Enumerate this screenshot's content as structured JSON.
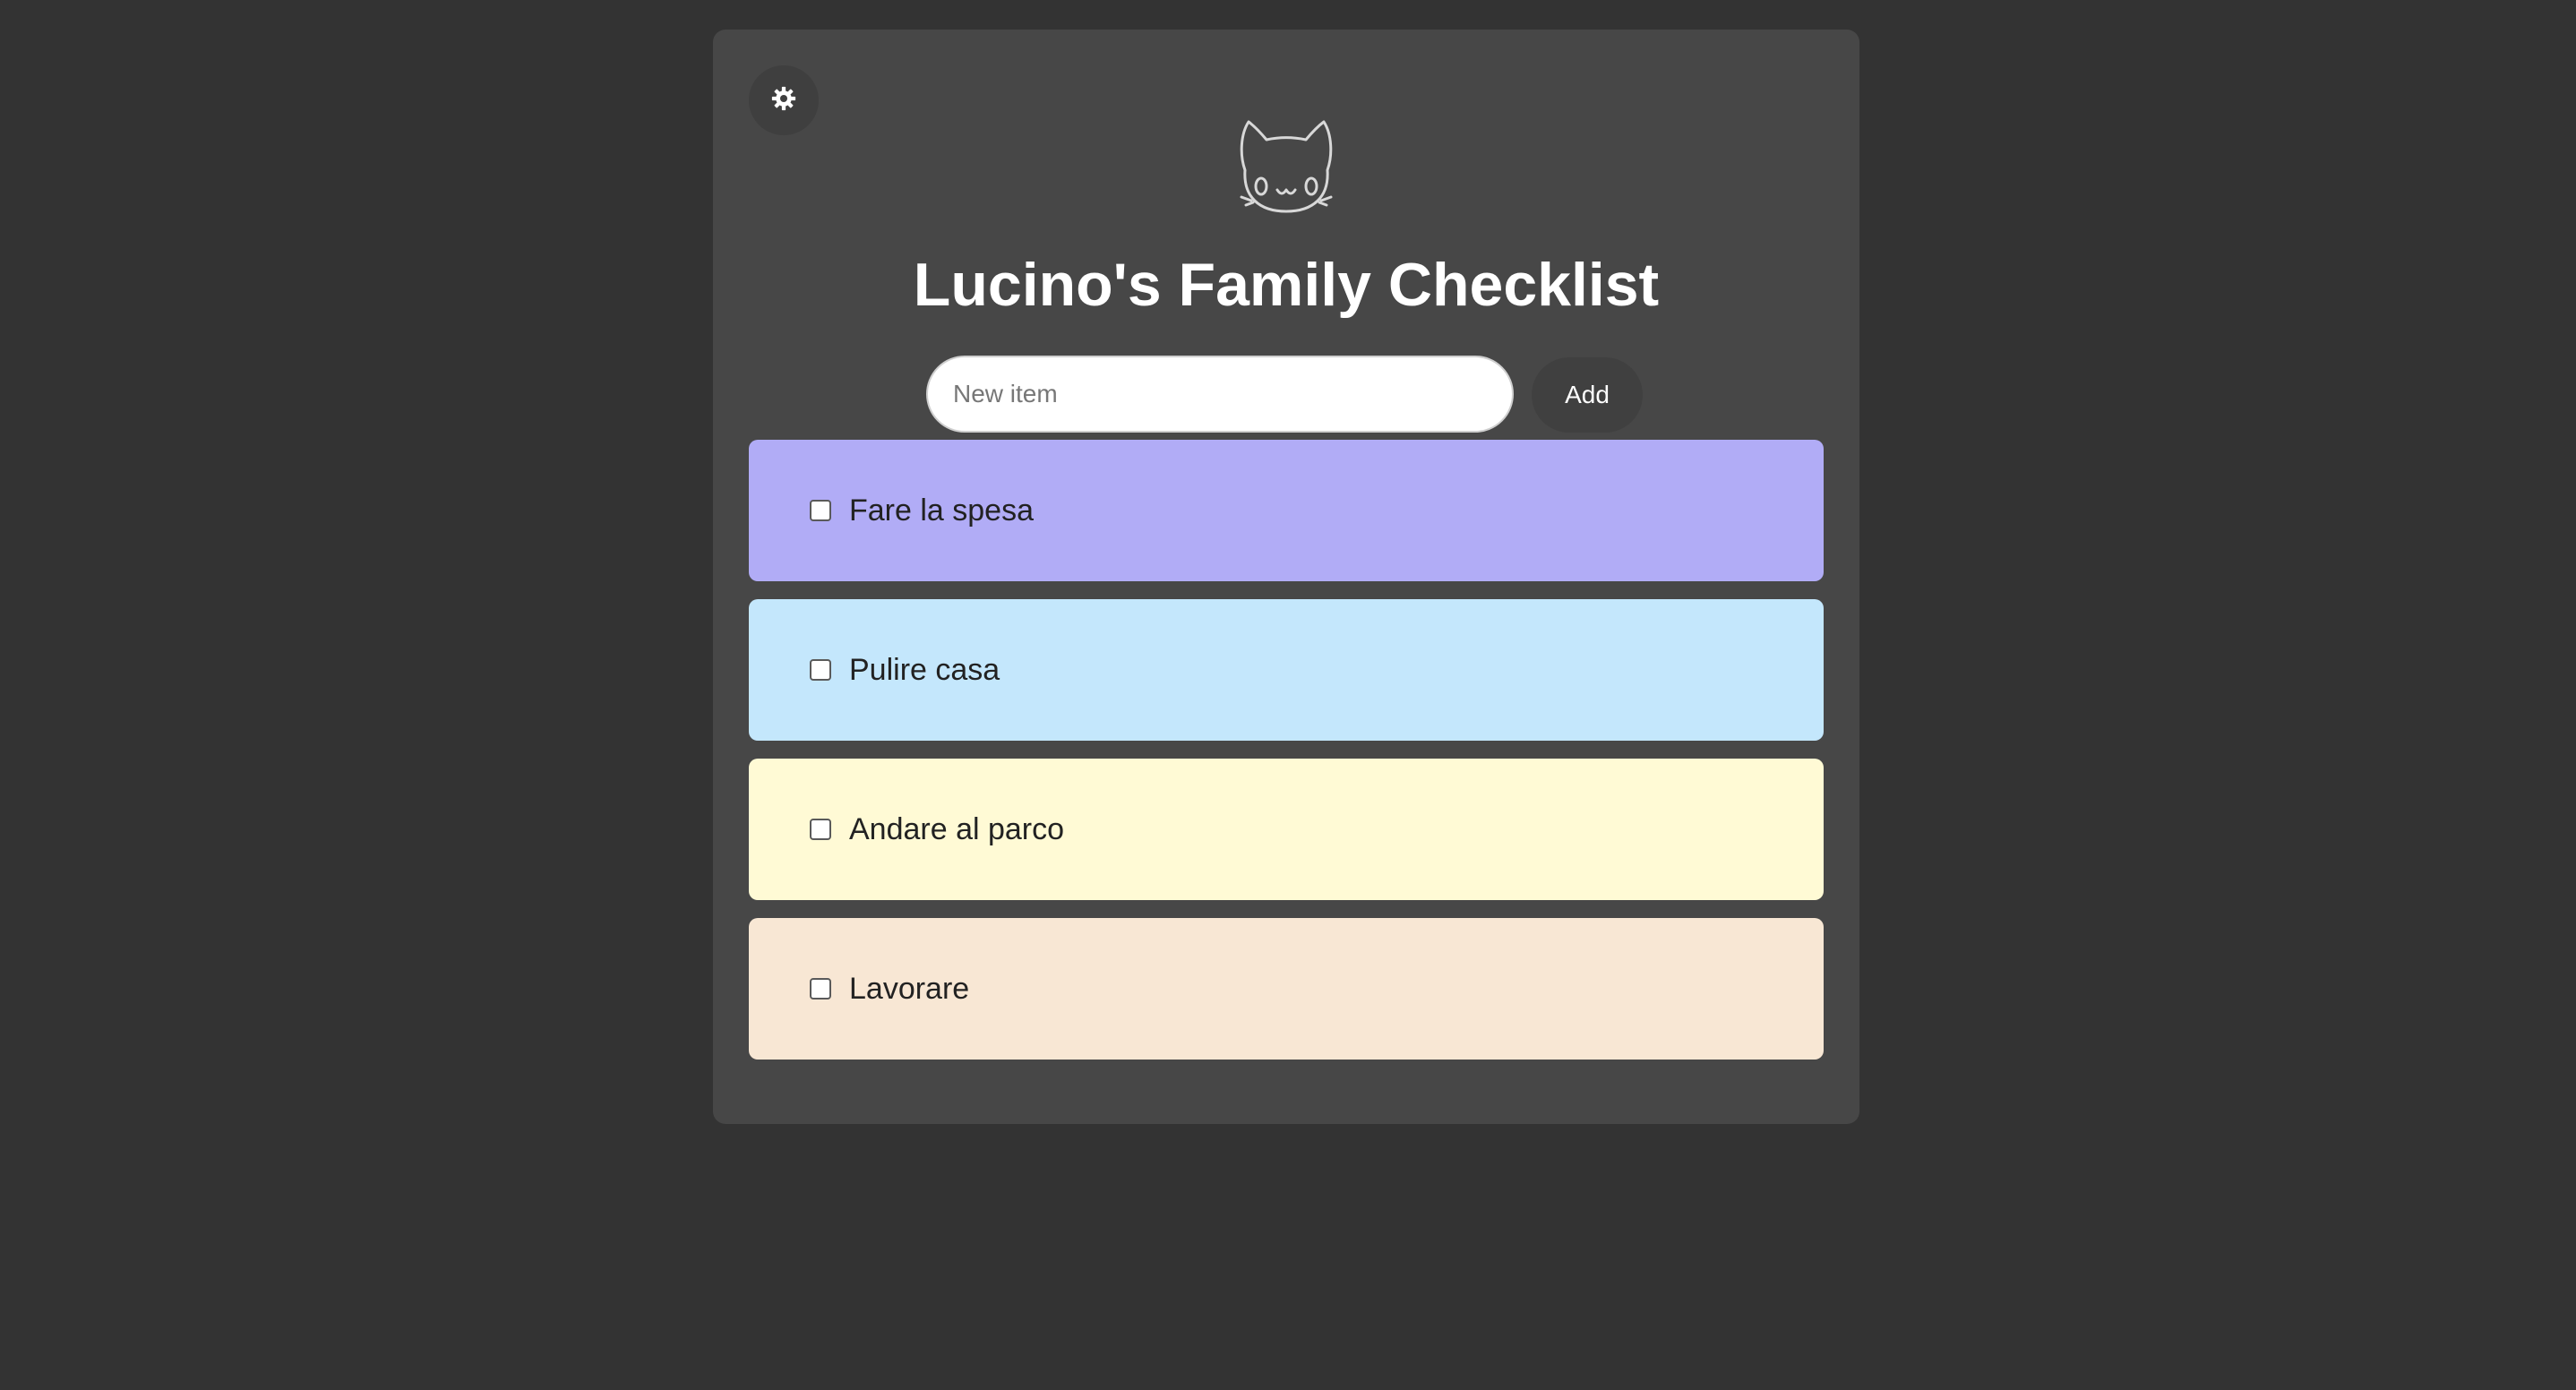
{
  "app": {
    "title": "Lucino's Family Checklist",
    "settings_icon": "gear-icon",
    "logo_icon": "cat-face-icon"
  },
  "form": {
    "input_value": "",
    "input_placeholder": "New item",
    "add_label": "Add"
  },
  "items": [
    {
      "label": "Fare la spesa",
      "checked": false,
      "color": "#b1acf6"
    },
    {
      "label": "Pulire casa",
      "checked": false,
      "color": "#c4e7fc"
    },
    {
      "label": "Andare al parco",
      "checked": false,
      "color": "#fffad5"
    },
    {
      "label": "Lavorare",
      "checked": false,
      "color": "#f8e7d4"
    }
  ],
  "colors": {
    "background": "#333333",
    "card": "#474747",
    "title": "#ffffff"
  }
}
